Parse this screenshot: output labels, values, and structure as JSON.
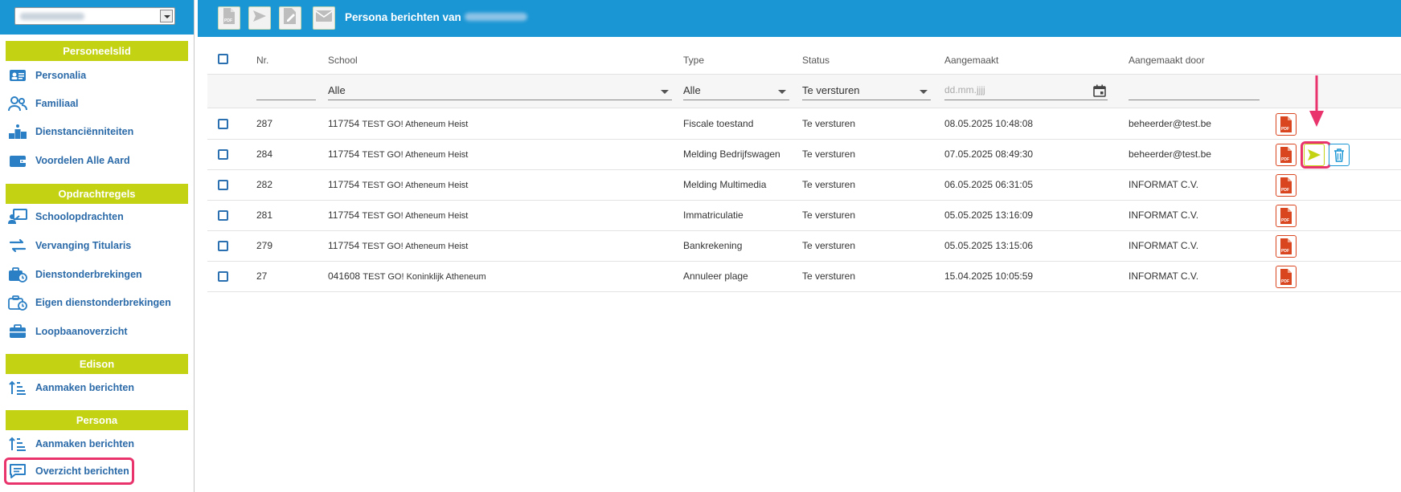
{
  "sidebar": {
    "sections": [
      {
        "title": "Personeelslid",
        "items": [
          "Personalia",
          "Familiaal",
          "Dienstanciënniteiten",
          "Voordelen Alle Aard"
        ]
      },
      {
        "title": "Opdrachtregels",
        "items": [
          "Schoolopdrachten",
          "Vervanging Titularis",
          "Dienstonderbrekingen",
          "Eigen dienstonderbrekingen",
          "Loopbaanoverzicht"
        ]
      },
      {
        "title": "Edison",
        "items": [
          "Aanmaken berichten"
        ]
      },
      {
        "title": "Persona",
        "items": [
          "Aanmaken berichten",
          "Overzicht berichten"
        ]
      }
    ]
  },
  "topbar": {
    "title": "Persona berichten van",
    "buttons": [
      "pdf-icon",
      "send-icon",
      "edit-doc-icon",
      "mail-icon"
    ]
  },
  "table": {
    "headers": {
      "nr": "Nr.",
      "school": "School",
      "type": "Type",
      "status": "Status",
      "created": "Aangemaakt",
      "created_by": "Aangemaakt door"
    },
    "filters": {
      "school": "Alle",
      "type": "Alle",
      "status": "Te versturen",
      "date_placeholder": "dd.mm.jjjj"
    },
    "rows": [
      {
        "nr": "287",
        "school_code": "117754",
        "school_name": "TEST GO! Atheneum Heist",
        "type": "Fiscale toestand",
        "status": "Te versturen",
        "created": "08.05.2025 10:48:08",
        "by": "beheerder@test.be"
      },
      {
        "nr": "284",
        "school_code": "117754",
        "school_name": "TEST GO! Atheneum Heist",
        "type": "Melding Bedrijfswagen",
        "status": "Te versturen",
        "created": "07.05.2025 08:49:30",
        "by": "beheerder@test.be"
      },
      {
        "nr": "282",
        "school_code": "117754",
        "school_name": "TEST GO! Atheneum Heist",
        "type": "Melding Multimedia",
        "status": "Te versturen",
        "created": "06.05.2025 06:31:05",
        "by": "INFORMAT C.V."
      },
      {
        "nr": "281",
        "school_code": "117754",
        "school_name": "TEST GO! Atheneum Heist",
        "type": "Immatriculatie",
        "status": "Te versturen",
        "created": "05.05.2025 13:16:09",
        "by": "INFORMAT C.V."
      },
      {
        "nr": "279",
        "school_code": "117754",
        "school_name": "TEST GO! Atheneum Heist",
        "type": "Bankrekening",
        "status": "Te versturen",
        "created": "05.05.2025 13:15:06",
        "by": "INFORMAT C.V."
      },
      {
        "nr": "27",
        "school_code": "041608",
        "school_name": "TEST GO! Koninklijk Atheneum",
        "type": "Annuleer plage",
        "status": "Te versturen",
        "created": "15.04.2025 10:05:59",
        "by": "INFORMAT C.V."
      }
    ]
  },
  "colors": {
    "accent_blue": "#1a96d4",
    "section_green": "#c3d314",
    "pdf_red": "#d9451f",
    "highlight_pink": "#e8336d"
  }
}
